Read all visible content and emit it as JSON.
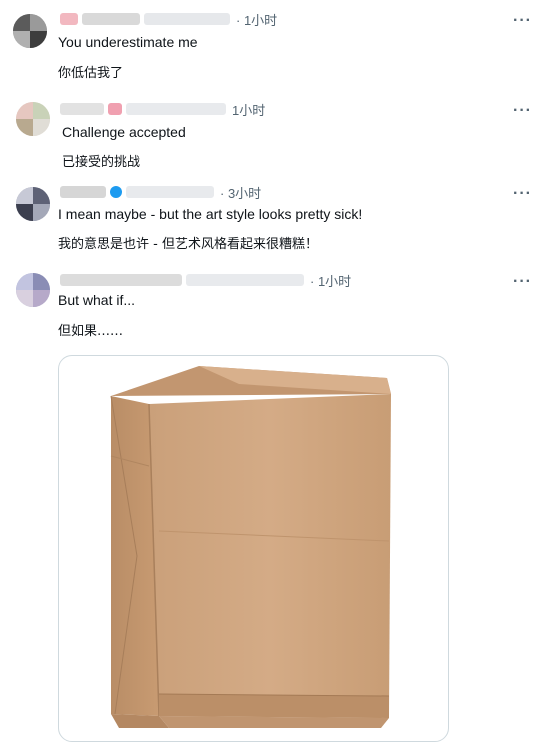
{
  "replies": [
    {
      "time": "· 1小时",
      "text_en": "You underestimate me",
      "text_zh": "你低估我了"
    },
    {
      "time": "1小时",
      "text_en": "Challenge accepted",
      "text_zh": "已接受的挑战"
    },
    {
      "time": "· 3小时",
      "text_en": "I mean maybe - but the art style looks pretty sick!",
      "text_zh": "我的意思是也许 - 但艺术风格看起来很糟糕！"
    },
    {
      "time": "· 1小时",
      "text_en": "But what if...",
      "text_zh": "但如果……"
    }
  ],
  "more_label": "···",
  "icons": {
    "more": "more-horizontal-icon",
    "verified": "verified-badge-icon",
    "media": "paper-bag-image"
  },
  "colors": {
    "text": "#0f1419",
    "secondary": "#536471",
    "verified": "#1d9bf0",
    "border": "#cfd9de"
  }
}
